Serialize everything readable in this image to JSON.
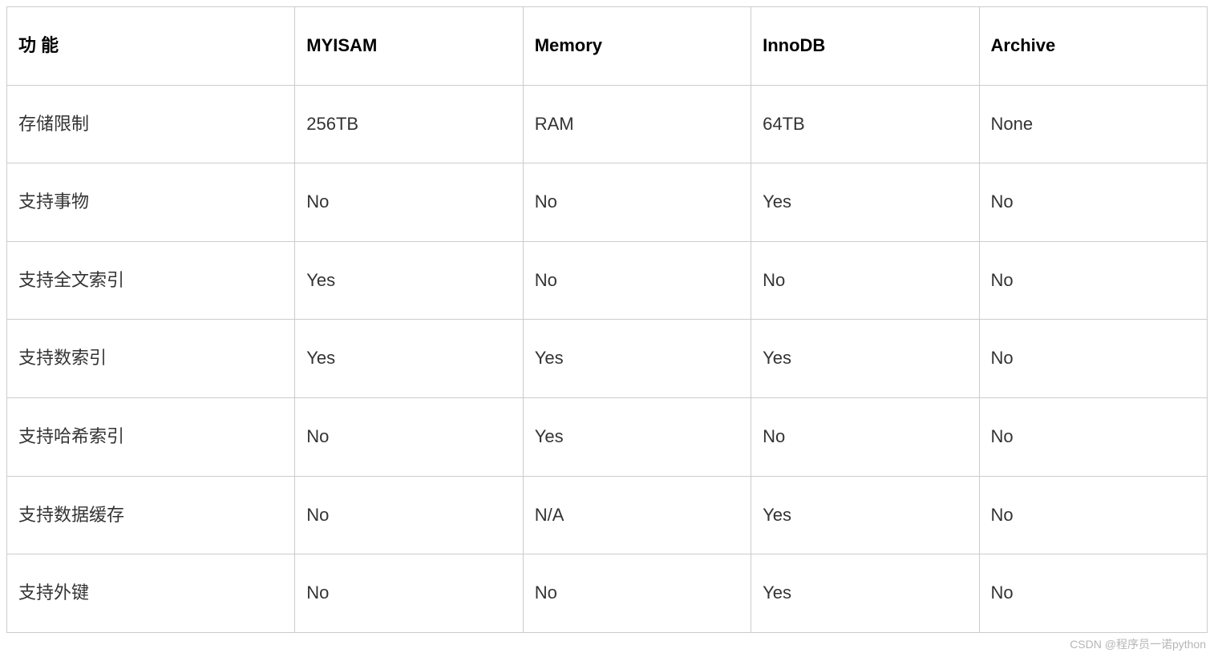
{
  "chart_data": {
    "type": "table",
    "headers": [
      "功 能",
      "MYISAM",
      "Memory",
      "InnoDB",
      "Archive"
    ],
    "rows": [
      {
        "feature": "存储限制",
        "myisam": "256TB",
        "memory": "RAM",
        "innodb": "64TB",
        "archive": "None"
      },
      {
        "feature": "支持事物",
        "myisam": "No",
        "memory": "No",
        "innodb": "Yes",
        "archive": "No"
      },
      {
        "feature": "支持全文索引",
        "myisam": "Yes",
        "memory": "No",
        "innodb": "No",
        "archive": "No"
      },
      {
        "feature": "支持数索引",
        "myisam": "Yes",
        "memory": "Yes",
        "innodb": "Yes",
        "archive": "No"
      },
      {
        "feature": "支持哈希索引",
        "myisam": "No",
        "memory": "Yes",
        "innodb": "No",
        "archive": "No"
      },
      {
        "feature": "支持数据缓存",
        "myisam": "No",
        "memory": "N/A",
        "innodb": "Yes",
        "archive": "No"
      },
      {
        "feature": "支持外键",
        "myisam": "No",
        "memory": "No",
        "innodb": "Yes",
        "archive": "No"
      }
    ]
  },
  "watermark": "CSDN @程序员一诺python"
}
